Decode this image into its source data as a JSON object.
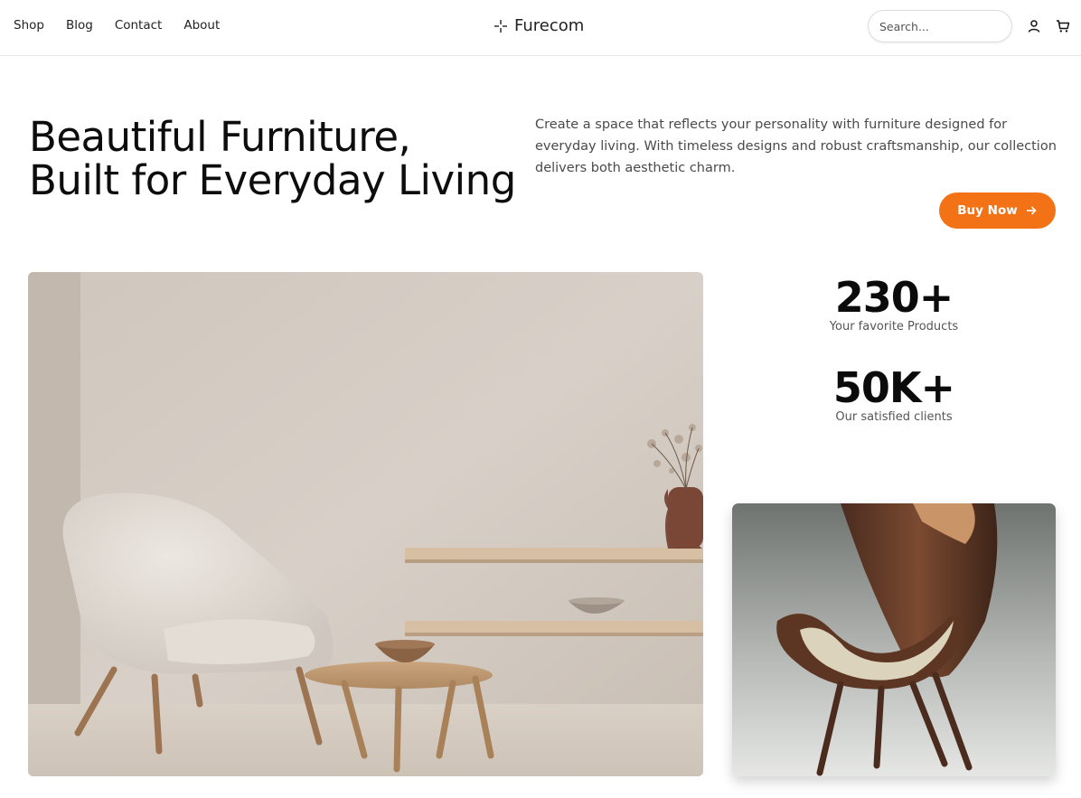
{
  "nav": {
    "items": [
      {
        "label": "Shop"
      },
      {
        "label": "Blog"
      },
      {
        "label": "Contact"
      },
      {
        "label": "About"
      }
    ]
  },
  "brand": {
    "name": "Furecom",
    "logo_icon": "sparkle-cross-icon"
  },
  "search": {
    "placeholder": "Search..."
  },
  "header_icons": {
    "user": "user-icon",
    "cart": "cart-icon"
  },
  "hero": {
    "title_line1": "Beautiful Furniture,",
    "title_line2": "Built for Everyday Living",
    "description": "Create a space that reflects your personality with furniture designed for everyday living. With timeless designs and robust craftsmanship, our collection delivers both aesthetic charm.",
    "cta_label": "Buy Now",
    "cta_icon": "arrow-right-icon"
  },
  "stats": [
    {
      "value": "230+",
      "label": "Your favorite Products"
    },
    {
      "value": "50K+",
      "label": "Our satisfied clients"
    }
  ],
  "colors": {
    "accent": "#f47216",
    "text": "#0d0d0d"
  }
}
